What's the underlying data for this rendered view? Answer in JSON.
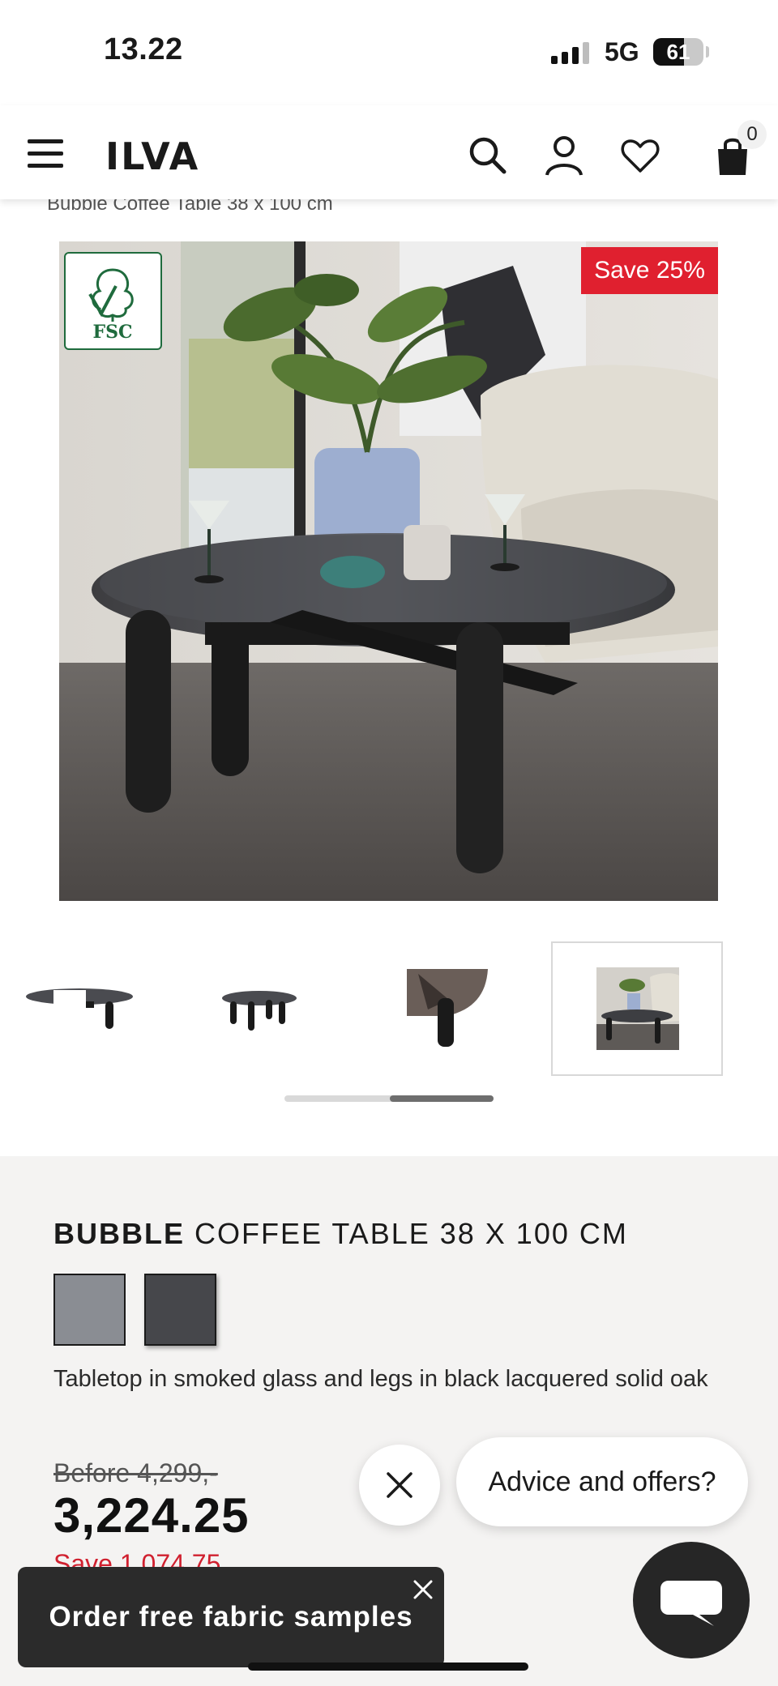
{
  "status_bar": {
    "time": "13.22",
    "network": "5G",
    "battery": "61",
    "battery_level": 0.61
  },
  "header": {
    "logo": "ILVA",
    "menu_icon": "hamburger-menu-icon",
    "search_icon": "search-icon",
    "account_icon": "user-icon",
    "wishlist_icon": "heart-icon",
    "cart_icon": "shopping-bag-icon",
    "cart_count": "0"
  },
  "breadcrumb": {
    "title": "Bubble Coffee Table 38 x 100 cm"
  },
  "gallery": {
    "badge_save": "Save 25%",
    "certification_label": "FSC",
    "thumbnail_count": 4,
    "active_thumbnail": 4,
    "scroll_position": 0.5
  },
  "product": {
    "name_brand": "BUBBLE",
    "name_rest": " COFFEE TABLE 38 X 100 CM",
    "swatches": [
      {
        "name": "smoked glass light",
        "color": "#8a8d93"
      },
      {
        "name": "smoked glass dark",
        "color": "#46474b"
      }
    ],
    "description": "Tabletop in smoked glass and legs in black lacquered solid oak",
    "price_before": "Before 4,299,-",
    "price_now": "3,224.25",
    "price_save": "Save 1,074.75"
  },
  "chat": {
    "prompt": "Advice and offers?",
    "close_icon": "close-icon",
    "launcher_icon": "chat-bubble-icon"
  },
  "fabric_banner": {
    "label": "Order free fabric samples",
    "close_icon": "close-icon"
  },
  "colors": {
    "sale_red": "#e0202f",
    "dark": "#2b2b2b",
    "panel_bg": "#f4f3f2",
    "fsc_green": "#1f6b3d"
  }
}
